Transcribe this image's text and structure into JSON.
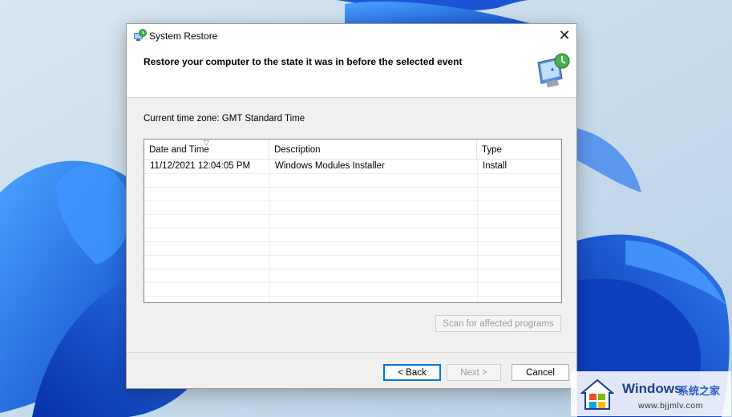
{
  "dialog": {
    "title": "System Restore",
    "close_glyph": "✕",
    "heading": "Restore your computer to the state it was in before the selected event",
    "timezone": "Current time zone: GMT Standard Time"
  },
  "list": {
    "columns": [
      "Date and Time",
      "Description",
      "Type"
    ],
    "sort_glyph": "▽",
    "rows": [
      [
        "11/12/2021 12:04:05 PM",
        "Windows Modules Installer",
        "Install"
      ]
    ]
  },
  "buttons": {
    "scan": "Scan for affected programs",
    "back": "< Back",
    "next": "Next >",
    "cancel": "Cancel"
  },
  "watermark": {
    "title": "Windows",
    "subtitle": "系统之家",
    "url": "www.bjjmlv.com"
  },
  "colors": {
    "accent": "#0078d7",
    "wallpaper_blue": "#1a5fd9",
    "watermark_text": "#1b3f8f"
  },
  "icons": [
    "system-restore-icon",
    "close-icon",
    "sort-arrow-icon",
    "restore-monitor-icon",
    "windows-logo-icon"
  ]
}
